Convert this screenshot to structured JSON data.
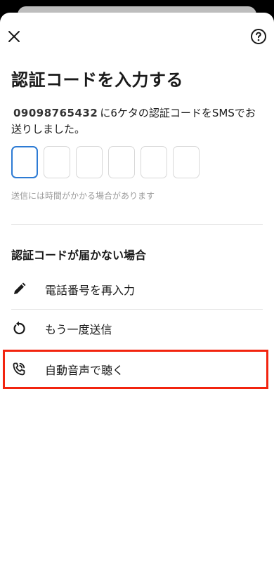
{
  "header": {
    "close_icon": "close-icon",
    "help_icon": "help-icon",
    "help_glyph": "?"
  },
  "page": {
    "title": "認証コードを入力する",
    "phone_number": "09098765432",
    "message_suffix": "に6ケタの認証コードをSMSでお送りしました。",
    "code_digits": [
      "",
      "",
      "",
      "",
      "",
      ""
    ],
    "hint": "送信には時間がかかる場合があります"
  },
  "not_received": {
    "title": "認証コードが届かない場合",
    "options": [
      {
        "label": "電話番号を再入力",
        "icon": "pencil-icon"
      },
      {
        "label": "もう一度送信",
        "icon": "refresh-icon"
      },
      {
        "label": "自動音声で聴く",
        "icon": "phone-call-icon"
      }
    ]
  },
  "colors": {
    "accent": "#2d7bd4",
    "highlight": "#f2240f"
  }
}
